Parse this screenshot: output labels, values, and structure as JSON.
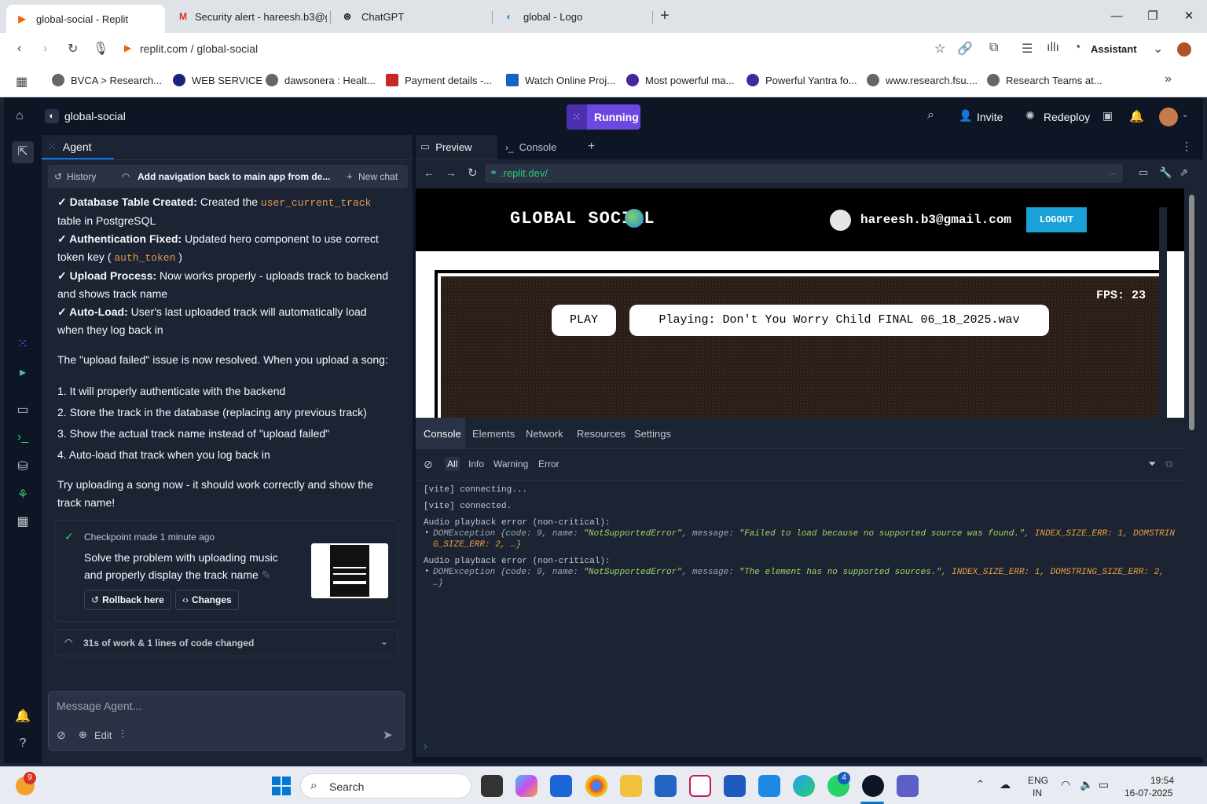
{
  "browser": {
    "tabs": [
      {
        "title": "global-social - Replit",
        "active": true
      },
      {
        "title": "Security alert - hareesh.b3@g",
        "active": false
      },
      {
        "title": "ChatGPT",
        "active": false
      },
      {
        "title": "global - Logo",
        "active": false
      }
    ],
    "url": "replit.com / global-social",
    "assistant_label": "Assistant",
    "bookmarks": [
      "BVCA > Research...",
      "WEB SERVICE",
      "dawsonera : Healt...",
      "Payment details -...",
      "Watch Online Proj...",
      "Most powerful ma...",
      "Powerful Yantra fo...",
      "www.research.fsu....",
      "Research Teams at..."
    ]
  },
  "replit": {
    "project_name": "global-social",
    "run_label": "Running",
    "invite_label": "Invite",
    "redeploy_label": "Redeploy",
    "agent": {
      "tab_label": "Agent",
      "history_label": "History",
      "thread_title": "Add navigation back to main app from de...",
      "new_chat_label": "New chat",
      "bullets": [
        {
          "bold": "✓ Database Table Created:",
          "text_before": " Created the ",
          "code": "user_current_track",
          "text_after": " table in PostgreSQL"
        },
        {
          "bold": "✓ Authentication Fixed:",
          "text_before": " Updated hero component to use correct token key ( ",
          "code": "auth_token",
          "text_after": " )"
        },
        {
          "bold": "✓ Upload Process:",
          "text_before": " Now works properly - uploads track to backend and shows track name",
          "code": "",
          "text_after": ""
        },
        {
          "bold": "✓ Auto-Load:",
          "text_before": " User's last uploaded track will automatically load when they log back in",
          "code": "",
          "text_after": ""
        }
      ],
      "resolved_text": "The \"upload failed\" issue is now resolved. When you upload a song:",
      "steps": [
        "1. It will properly authenticate with the backend",
        "2. Store the track in the database (replacing any previous track)",
        "3. Show the actual track name instead of \"upload failed\"",
        "4. Auto-load that track when you log back in"
      ],
      "closing_text": "Try uploading a song now - it should work correctly and show the track name!",
      "checkpoint": {
        "label": "Checkpoint made 1 minute ago",
        "description": "Solve the problem with uploading music and properly display the track name",
        "rollback_label": "Rollback here",
        "changes_label": "Changes"
      },
      "work_summary": "31s of work & 1 lines of code changed",
      "message_placeholder": "Message Agent...",
      "edit_label": "Edit"
    },
    "preview": {
      "tab_preview": "Preview",
      "tab_console": "Console",
      "url": ".replit.dev/",
      "site": {
        "brand": "GLOBAL SOCIAL",
        "user_email": "hareesh.b3@gmail.com",
        "logout_label": "LOGOUT",
        "fps_text": "FPS: 23",
        "play_label": "PLAY",
        "now_playing": "Playing: Don't You Worry Child FINAL 06_18_2025.wav"
      }
    },
    "devtools": {
      "tabs": [
        "Console",
        "Elements",
        "Network",
        "Resources",
        "Settings"
      ],
      "filters": [
        "All",
        "Info",
        "Warning",
        "Error"
      ],
      "lines": {
        "l1": "[vite] connecting...",
        "l2": "[vite] connected.",
        "l3": "Audio playback error (non-critical):",
        "l4_prefix": "DOMException {code: 9, name: ",
        "l4_name": "\"NotSupportedError\"",
        "l4_mid": ", message: ",
        "l4_msg": "\"Failed to load because no supported source was found.\"",
        "l4_suffix": ", INDEX_SIZE_ERR: 1, DOMSTRIN",
        "l4_cont": "G_SIZE_ERR: 2, …}",
        "l5": "Audio playback error (non-critical):",
        "l6_prefix": "DOMException {code: 9, name: ",
        "l6_name": "\"NotSupportedError\"",
        "l6_mid": ", message: ",
        "l6_msg": "\"The element has no supported sources.\"",
        "l6_suffix": ", INDEX_SIZE_ERR: 1, DOMSTRING_SIZE_ERR: 2,",
        "l6_cont": "…}"
      }
    }
  },
  "taskbar": {
    "search_placeholder": "Search",
    "notif_count": "9",
    "whatsapp_badge": "4",
    "lang_line1": "ENG",
    "lang_line2": "IN",
    "time": "19:54",
    "date": "16-07-2025"
  },
  "colors": {
    "run_button": "#6b49e0",
    "logout_button": "#1ba1d8",
    "code_orange": "#e39b4f",
    "app_bg": "#0e1525",
    "panel_bg": "#1c2333"
  }
}
